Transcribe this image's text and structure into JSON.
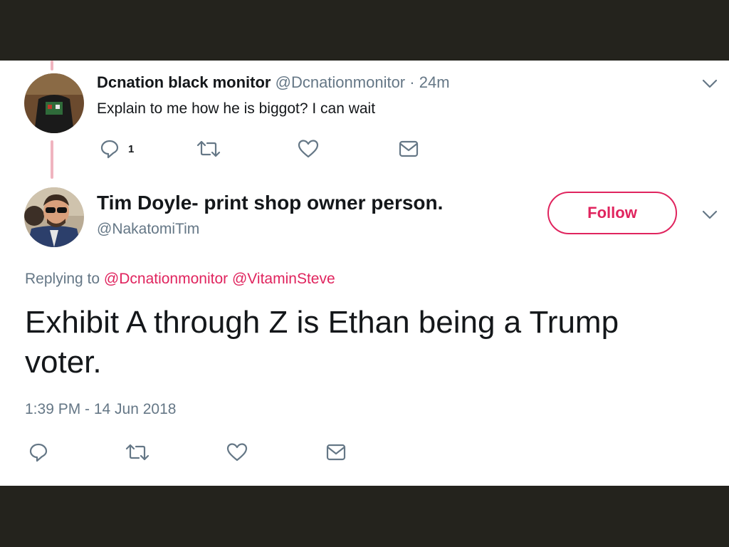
{
  "reply": {
    "display_name": "Dcnation black monitor",
    "handle": "@Dcnationmonitor",
    "separator": "·",
    "time": "24m",
    "text": "Explain to me how he is biggot? I can wait",
    "reply_count": "1",
    "icons": [
      "reply-icon",
      "retweet-icon",
      "like-icon",
      "dm-icon",
      "chevron-down-icon"
    ]
  },
  "main_tweet": {
    "display_name": "Tim Doyle- print shop owner person.",
    "handle": "@NakatomiTim",
    "follow_label": "Follow",
    "replying_label": "Replying to",
    "mentions": [
      "@Dcnationmonitor",
      "@VitaminSteve"
    ],
    "text": "Exhibit A through Z is Ethan being a Trump voter.",
    "timestamp": "1:39 PM - 14 Jun 2018",
    "icons": [
      "reply-icon",
      "retweet-icon",
      "like-icon",
      "dm-icon",
      "chevron-down-icon"
    ]
  },
  "colors": {
    "accent": "#e0245e",
    "muted": "#657786",
    "text": "#14171a",
    "thread_line": "#f0b4bf",
    "frame": "#24231d"
  }
}
